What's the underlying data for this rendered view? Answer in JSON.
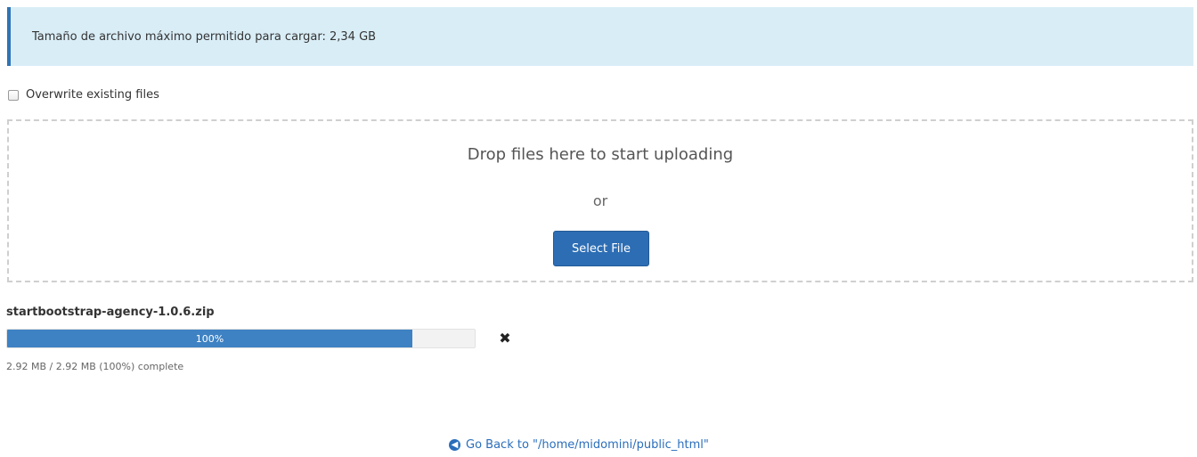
{
  "banner": {
    "text": "Tamaño de archivo máximo permitido para cargar: 2,34 GB"
  },
  "overwrite": {
    "label": "Overwrite existing files",
    "checked": false
  },
  "dropzone": {
    "title": "Drop files here to start uploading",
    "or": "or",
    "select_label": "Select File"
  },
  "upload": {
    "file_name": "startbootstrap-agency-1.0.6.zip",
    "progress_label": "100%",
    "progress_value": 100,
    "status": "2.92 MB / 2.92 MB (100%) complete",
    "cancel_icon": "close-icon"
  },
  "footer": {
    "go_back": "Go Back to \"/home/midomini/public_html\"",
    "icon": "circle-arrow-left-icon"
  }
}
